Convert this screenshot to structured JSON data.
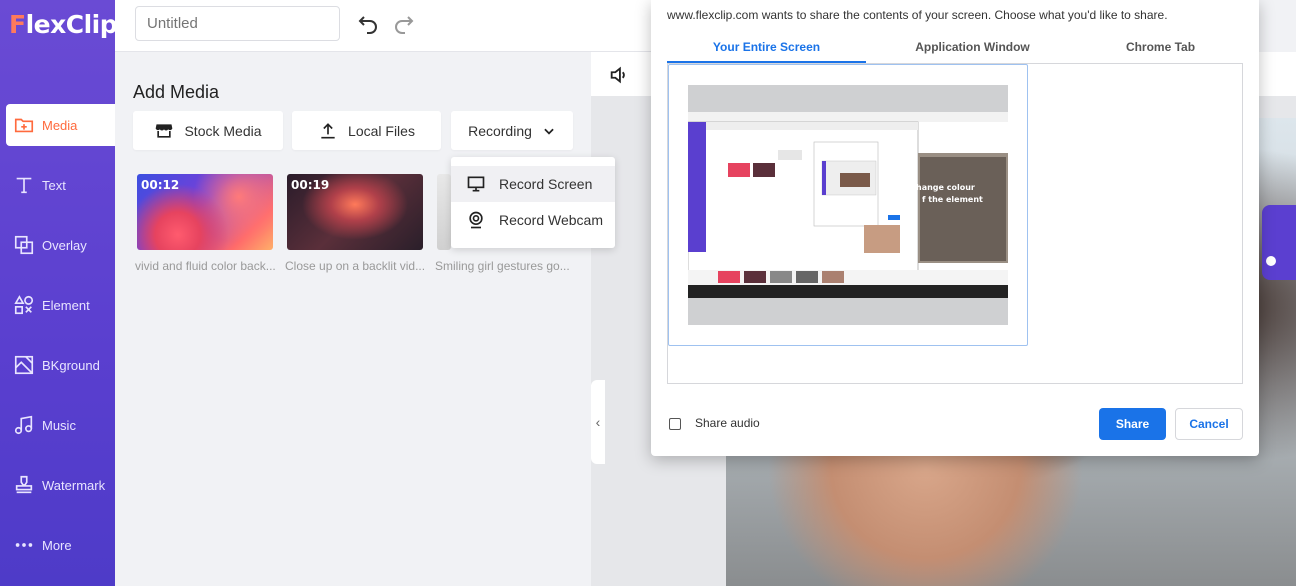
{
  "app": {
    "logo_text_accent": "F",
    "logo_text_rest": "lexClip",
    "brand_color": "#5a3fcf",
    "accent_color": "#ff6a3d"
  },
  "sidebar": {
    "items": [
      {
        "label": "Media",
        "icon": "media-plus-icon",
        "active": true
      },
      {
        "label": "Text",
        "icon": "text-icon"
      },
      {
        "label": "Overlay",
        "icon": "overlay-icon"
      },
      {
        "label": "Element",
        "icon": "element-shapes-icon"
      },
      {
        "label": "BKground",
        "icon": "background-icon"
      },
      {
        "label": "Music",
        "icon": "music-note-icon"
      },
      {
        "label": "Watermark",
        "icon": "watermark-stamp-icon"
      },
      {
        "label": "More",
        "icon": "more-dots-icon"
      }
    ]
  },
  "topbar": {
    "title_placeholder": "Untitled"
  },
  "media": {
    "title": "Add Media",
    "buttons": {
      "stock": "Stock Media",
      "local": "Local Files",
      "recording": "Recording"
    },
    "recording_menu": [
      "Record Screen",
      "Record Webcam"
    ],
    "items": [
      {
        "duration": "00:12",
        "caption": "vivid and fluid color back..."
      },
      {
        "duration": "00:19",
        "caption": "Close up on a backlit vid..."
      },
      {
        "duration": "",
        "caption": "Smiling girl gestures go..."
      }
    ]
  },
  "share_dialog": {
    "message": "www.flexclip.com wants to share the contents of your screen. Choose what you'd like to share.",
    "tabs": [
      "Your Entire Screen",
      "Application Window",
      "Chrome Tab"
    ],
    "active_tab": "Your Entire Screen",
    "share_audio_label": "Share audio",
    "share_audio_checked": false,
    "share_button": "Share",
    "cancel_button": "Cancel",
    "thumbnail_text": "hange colour\nf the element",
    "primary_color": "#1a73e8"
  }
}
